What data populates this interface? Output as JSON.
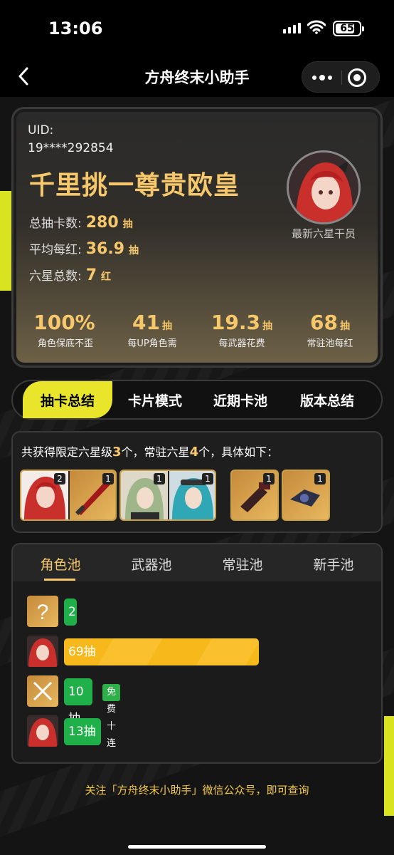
{
  "status": {
    "time": "13:06",
    "battery": "65"
  },
  "nav": {
    "title": "方舟终末小助手"
  },
  "profile": {
    "uid_label": "UID:",
    "uid_value": "19****292854",
    "rank_title": "千里挑一尊贵欧皇",
    "stats": [
      {
        "label": "总抽卡数:",
        "value": "280",
        "unit": "抽"
      },
      {
        "label": "平均每红:",
        "value": "36.9",
        "unit": "抽"
      },
      {
        "label": "六星总数:",
        "value": "7",
        "unit": "红"
      }
    ],
    "latest_label": "最新六星干员",
    "summary": [
      {
        "value": "100%",
        "unit": "",
        "label": "角色保底不歪"
      },
      {
        "value": "41",
        "unit": "抽",
        "label": "每UP角色需"
      },
      {
        "value": "19.3",
        "unit": "抽",
        "label": "每武器花费"
      },
      {
        "value": "68",
        "unit": "抽",
        "label": "常驻池每红"
      }
    ]
  },
  "main_tabs": [
    "抽卡总结",
    "卡片模式",
    "近期卡池",
    "版本总结"
  ],
  "obtained": {
    "prefix": "共获得限定六星级",
    "limited_count": "3",
    "mid": "个，常驻六星",
    "standard_count": "4",
    "suffix": "个，具体如下：",
    "tile_counts": [
      "2",
      "1",
      "1",
      "1",
      "1",
      "1"
    ]
  },
  "pool_tabs": [
    "角色池",
    "武器池",
    "常驻池",
    "新手池"
  ],
  "pulls": [
    {
      "icon": "question-icon",
      "label": "2",
      "progress": 2
    },
    {
      "icon": "operator-portrait",
      "label": "69抽",
      "progress": 69
    },
    {
      "icon": "cross-icon",
      "label": "10抽",
      "progress": 10,
      "tag": "免费十连"
    },
    {
      "icon": "operator-portrait",
      "label": "13抽",
      "progress": 13
    }
  ],
  "footer": "关注「方舟终末小助手」微信公众号，即可查询",
  "colors": {
    "accent": "#f6c86b",
    "tab_active": "#e9e52a",
    "green": "#20b049",
    "gold": "#fbc02d"
  }
}
